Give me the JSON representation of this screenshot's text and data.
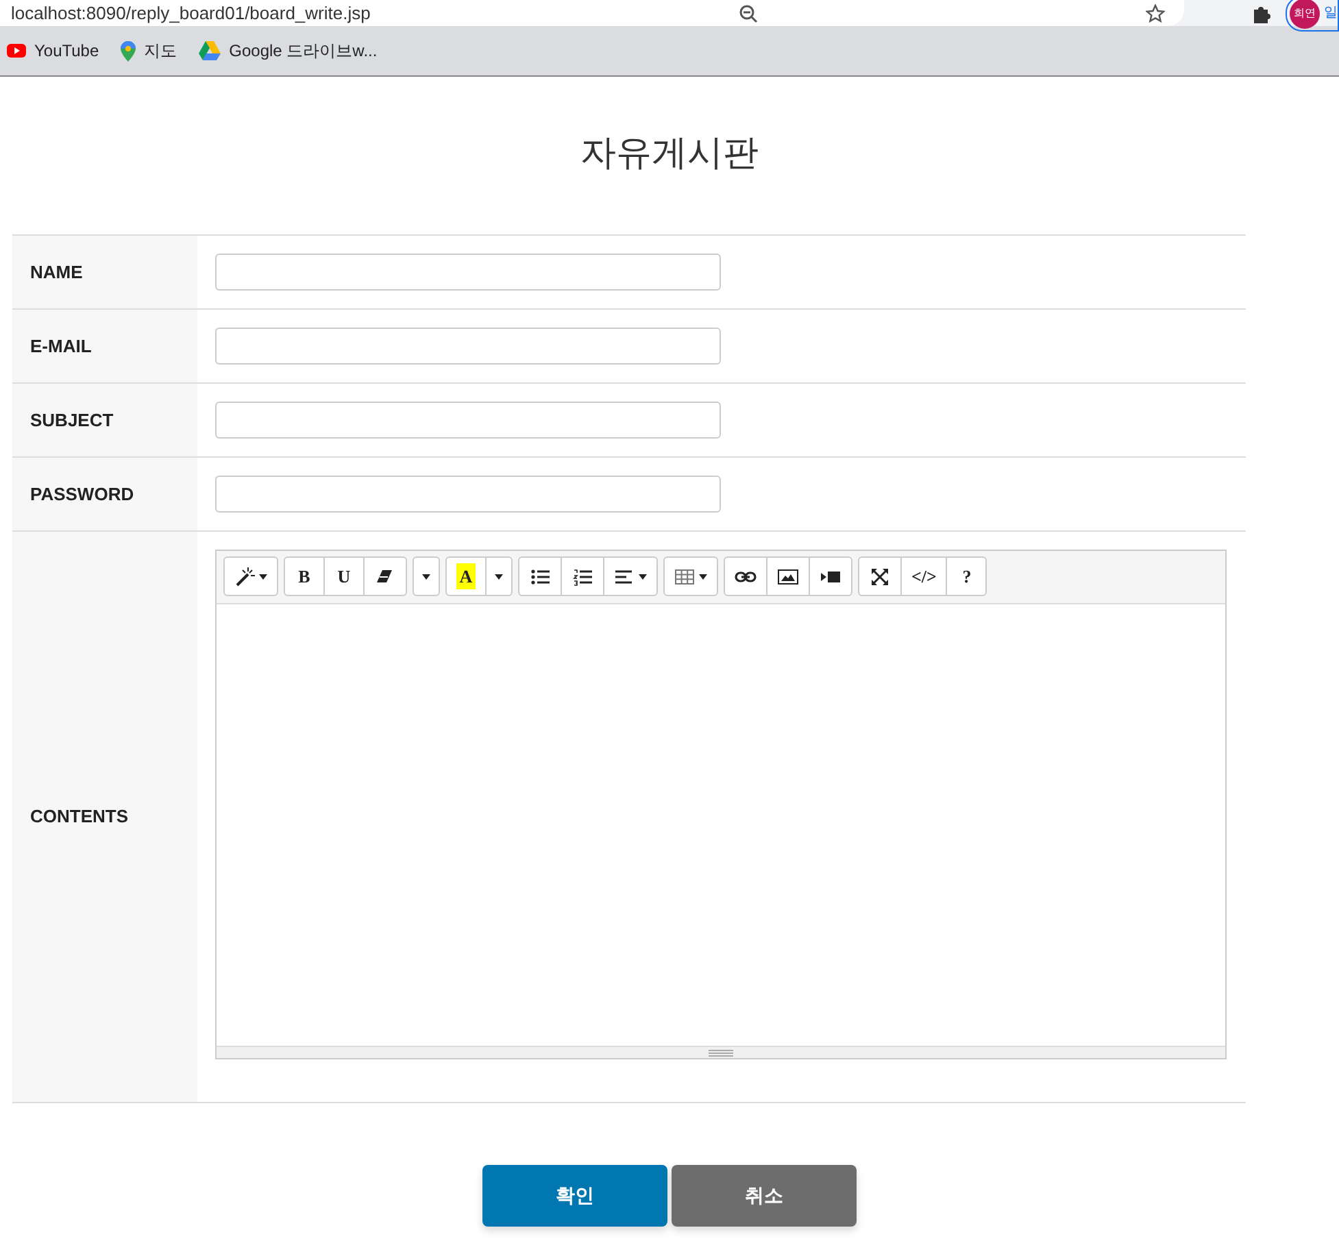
{
  "browser": {
    "url": "localhost:8090/reply_board01/board_write.jsp",
    "profile": "희연",
    "profile_extra": "일",
    "bookmarks": [
      {
        "label": "YouTube"
      },
      {
        "label": "지도"
      },
      {
        "label": "Google 드라이브w..."
      }
    ]
  },
  "title": "자유게시판",
  "fields": [
    {
      "label": "NAME",
      "kind": "input"
    },
    {
      "label": "E-MAIL",
      "kind": "input"
    },
    {
      "label": "SUBJECT",
      "kind": "input"
    },
    {
      "label": "PASSWORD",
      "kind": "input"
    },
    {
      "label": "CONTENTS",
      "kind": "editor"
    }
  ],
  "toolbar": [
    [
      {
        "kind": "icon",
        "caret": true
      }
    ],
    [
      {
        "kind": "text",
        "label": "B"
      },
      {
        "kind": "text",
        "label": "U"
      },
      {
        "kind": "icon"
      }
    ],
    [
      {
        "kind": "caret"
      }
    ],
    [
      {
        "kind": "highlight",
        "label": "A"
      },
      {
        "kind": "caret"
      }
    ],
    [
      {
        "kind": "icon"
      },
      {
        "kind": "icon"
      },
      {
        "kind": "icon",
        "caret": true
      }
    ],
    [
      {
        "kind": "icon",
        "caret": true
      }
    ],
    [
      {
        "kind": "icon"
      },
      {
        "kind": "icon"
      },
      {
        "kind": "icon"
      }
    ],
    [
      {
        "kind": "icon"
      },
      {
        "kind": "text",
        "label": "</>"
      },
      {
        "kind": "text",
        "label": "?"
      }
    ]
  ],
  "buttons": [
    {
      "label": "확인",
      "kind": "primary"
    },
    {
      "label": "취소",
      "kind": "secondary"
    }
  ]
}
